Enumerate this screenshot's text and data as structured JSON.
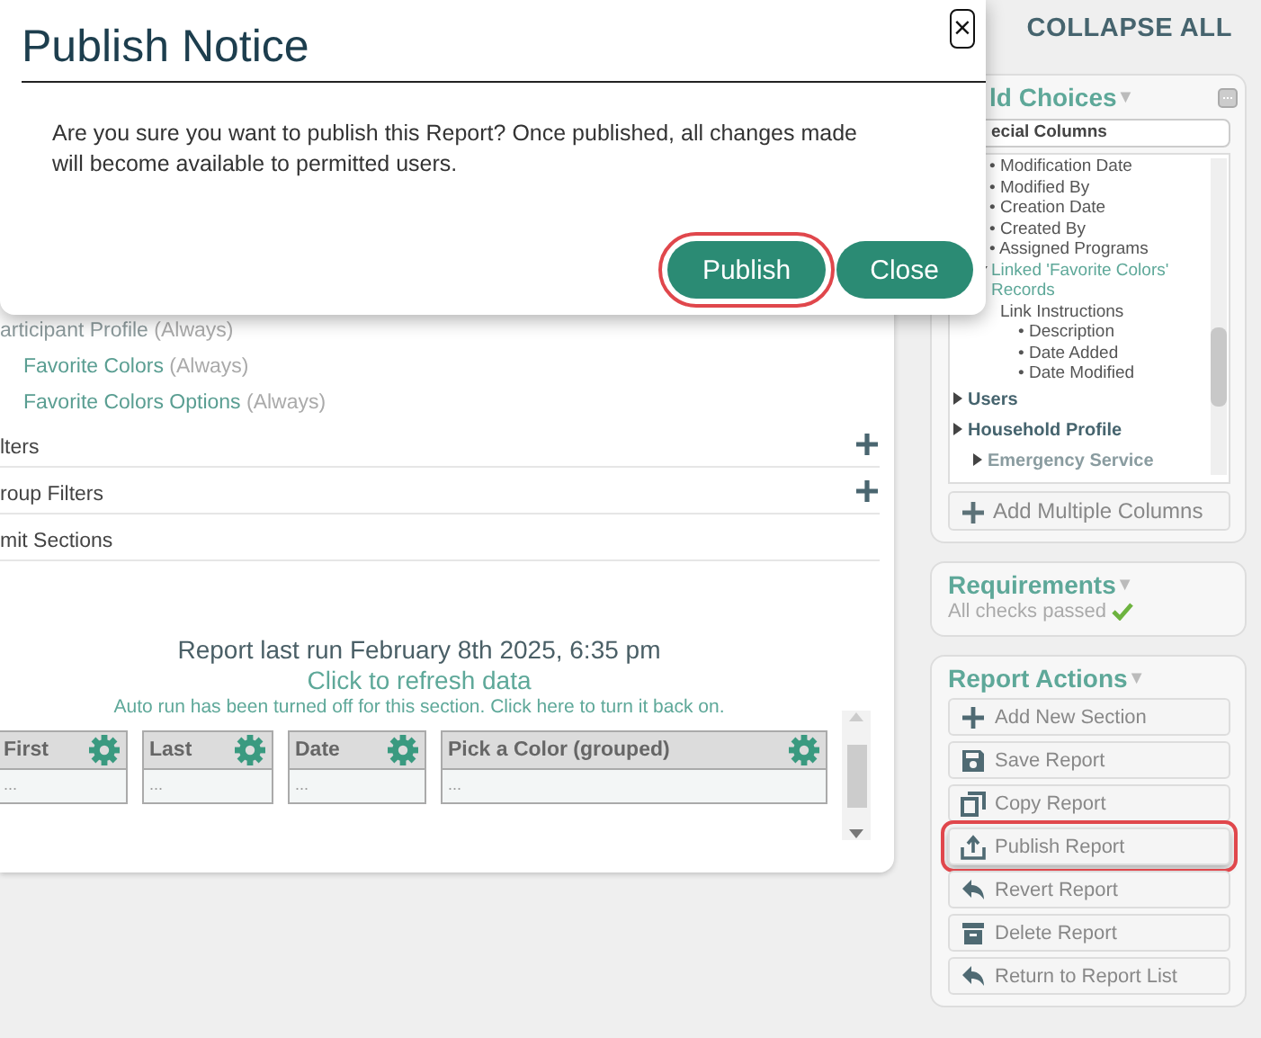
{
  "modal": {
    "title": "Publish Notice",
    "close_icon": "×",
    "message": "Are you sure you want to publish this Report? Once published, all changes made will become available to permitted users.",
    "buttons": [
      {
        "label": "Publish",
        "highlighted": true
      },
      {
        "label": "Close",
        "highlighted": false
      }
    ]
  },
  "report": {
    "sections": [
      {
        "name": "articipant Profile",
        "note": "(Always)",
        "children": [
          {
            "name": "Favorite Colors",
            "note": "(Always)"
          },
          {
            "name": "Favorite Colors Options",
            "note": "(Always)"
          }
        ]
      }
    ],
    "filters": [
      {
        "label": "lters",
        "has_add": true
      },
      {
        "label": "roup Filters",
        "has_add": true
      },
      {
        "label": "mit Sections",
        "has_add": false
      }
    ],
    "last_run": "Report last run February 8th 2025, 6:35 pm",
    "refresh_link": "Click to refresh data",
    "auto_run_note": "Auto run has been turned off for this section. Click here to turn it back on.",
    "columns": [
      {
        "label": "First",
        "cell": "..."
      },
      {
        "label": "Last",
        "cell": "..."
      },
      {
        "label": "Date",
        "cell": "..."
      },
      {
        "label": "Pick a Color (grouped)",
        "cell": "..."
      }
    ]
  },
  "sidebar": {
    "collapse_all": "COLLAPSE ALL",
    "field_choices": {
      "title": "ld Choices",
      "caret": "▼",
      "category": "ecial Columns",
      "tree": [
        {
          "label": "• Modification Date",
          "kind": "field"
        },
        {
          "label": "• Modified By",
          "kind": "field"
        },
        {
          "label": "• Creation Date",
          "kind": "field"
        },
        {
          "label": "• Created By",
          "kind": "field"
        },
        {
          "label": "• Assigned Programs",
          "kind": "field"
        },
        {
          "label": "Linked 'Favorite Colors' Records",
          "kind": "link",
          "expanded": true,
          "children": [
            {
              "label": "Link Instructions",
              "kind": "group",
              "children": [
                {
                  "label": "• Description",
                  "kind": "field"
                },
                {
                  "label": "• Date Added",
                  "kind": "field"
                },
                {
                  "label": "• Date Modified",
                  "kind": "field"
                }
              ]
            }
          ]
        },
        {
          "label": "Users",
          "kind": "section",
          "expanded": false
        },
        {
          "label": "Household Profile",
          "kind": "section",
          "expanded": false
        },
        {
          "label": "Emergency Service",
          "kind": "subsection",
          "expanded": false
        }
      ],
      "add_button": "Add Multiple Columns"
    },
    "requirements": {
      "title": "Requirements",
      "caret": "▼",
      "status": "All checks passed",
      "passed": true
    },
    "actions": {
      "title": "Report Actions",
      "caret": "▼",
      "buttons": [
        {
          "label": "Add New Section",
          "kind": "add",
          "highlighted": false
        },
        {
          "label": "Save Report",
          "kind": "save",
          "highlighted": false
        },
        {
          "label": "Copy Report",
          "kind": "copy",
          "highlighted": false
        },
        {
          "label": "Publish Report",
          "kind": "publish",
          "highlighted": true
        },
        {
          "label": "Revert Report",
          "kind": "revert",
          "highlighted": false
        },
        {
          "label": "Delete Report",
          "kind": "delete",
          "highlighted": false
        },
        {
          "label": "Return to Report List",
          "kind": "return",
          "highlighted": false
        }
      ]
    }
  }
}
